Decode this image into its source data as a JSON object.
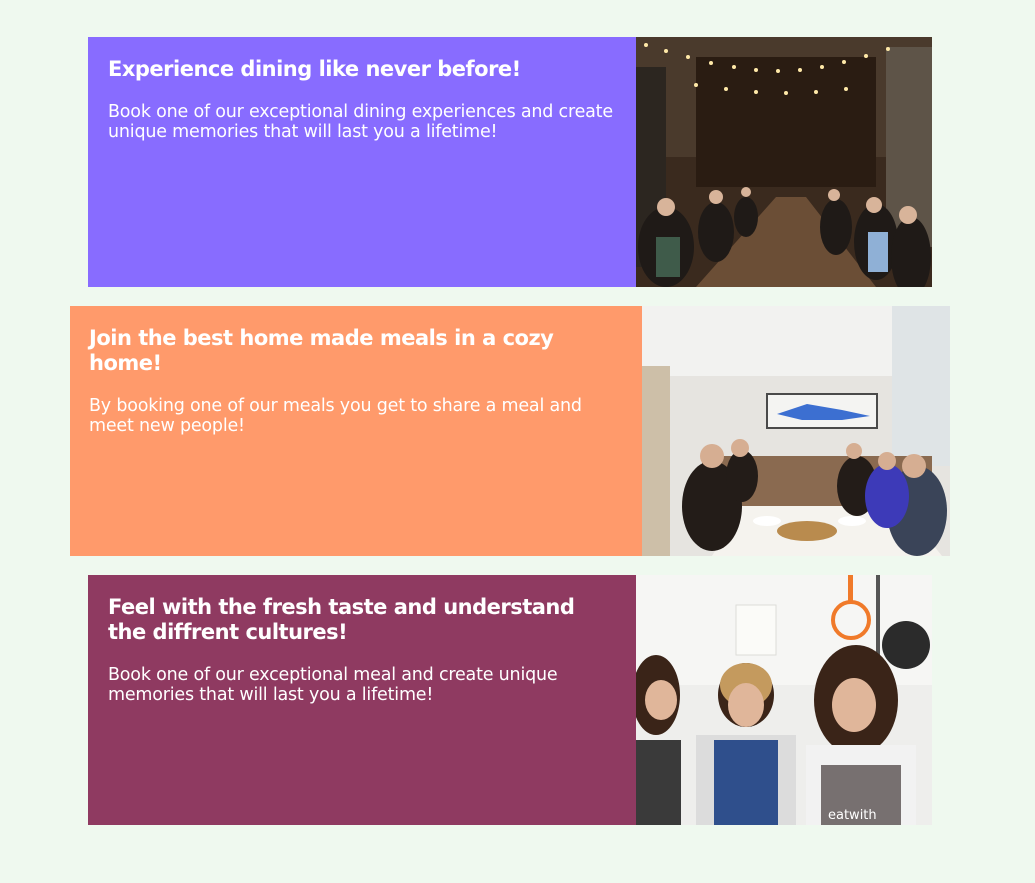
{
  "cards": [
    {
      "title": "Experience dining like never before!",
      "body": "Book one of our exceptional dining experiences and create unique memories that will last you a lifetime!",
      "color": "#886cff",
      "image": "outdoor-string-lights-long-table-dinner"
    },
    {
      "title": "Join the best home made meals in a cozy home!",
      "body": "By booking one of our meals you get to share a meal and meet new people!",
      "color": "#ff9a6b",
      "image": "home-dining-table-friends-photo"
    },
    {
      "title": "Feel with the fresh taste and understand the diffrent cultures!",
      "body": "Book one of our exceptional meal and create unique memories that will last you a lifetime!",
      "color": "#8f3a61",
      "image": "women-cooking-together-kitchen-photo",
      "apron_text": "eatwith"
    }
  ]
}
